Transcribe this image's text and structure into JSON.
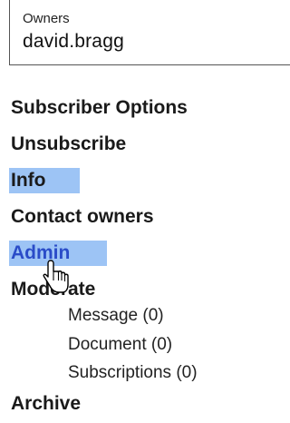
{
  "owners": {
    "label": "Owners",
    "value": "david.bragg"
  },
  "menu": [
    {
      "label": "Subscriber Options"
    },
    {
      "label": "Unsubscribe"
    },
    {
      "label": "Info",
      "highlighted": true
    },
    {
      "label": "Contact owners"
    },
    {
      "label": "Admin",
      "highlighted": true
    },
    {
      "label": "Moderate"
    }
  ],
  "moderate_sub": [
    {
      "label": "Message (0)"
    },
    {
      "label": "Document (0)"
    },
    {
      "label": "Subscriptions (0)"
    }
  ],
  "archive": {
    "label": "Archive"
  },
  "colors": {
    "highlight": "#9dc4f5",
    "admin_text": "#2a4cc8"
  },
  "cursor": {
    "icon": "hand-pointer-icon"
  }
}
